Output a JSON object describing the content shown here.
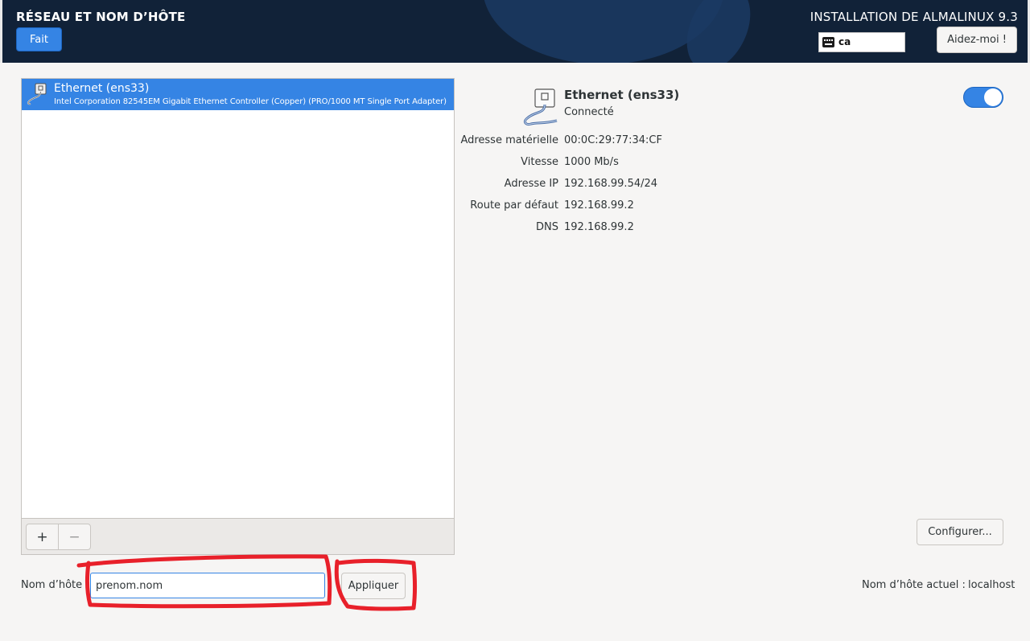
{
  "header": {
    "page_title": "RÉSEAU ET NOM D’HÔTE",
    "done_label": "Fait",
    "product_title": "INSTALLATION DE ALMALINUX 9.3",
    "keyboard_layout": "ca",
    "help_label": "Aidez-moi !"
  },
  "device_list": {
    "items": [
      {
        "name": "Ethernet (ens33)",
        "description": "Intel Corporation 82545EM Gigabit Ethernet Controller (Copper) (PRO/1000 MT Single Port Adapter)"
      }
    ],
    "add_label": "+",
    "remove_label": "−"
  },
  "detail": {
    "name": "Ethernet (ens33)",
    "status": "Connecté",
    "enabled": true,
    "properties": [
      {
        "label": "Adresse matérielle",
        "value": "00:0C:29:77:34:CF"
      },
      {
        "label": "Vitesse",
        "value": "1000 Mb/s"
      },
      {
        "label": "Adresse IP",
        "value": "192.168.99.54/24"
      },
      {
        "label": "Route par défaut",
        "value": "192.168.99.2"
      },
      {
        "label": "DNS",
        "value": "192.168.99.2"
      }
    ],
    "configure_label": "Configurer..."
  },
  "hostname": {
    "label": "Nom d’hôte :",
    "value": "prenom.nom",
    "apply_label": "Appliquer",
    "current_label": "Nom d’hôte actuel :",
    "current_value": "localhost"
  },
  "colors": {
    "header_bg": "#112238",
    "accent": "#3584e4",
    "annotation": "#e8202a"
  },
  "icons": {
    "device_icon": "ethernet-cable-icon",
    "keyboard_icon": "keyboard-icon"
  }
}
